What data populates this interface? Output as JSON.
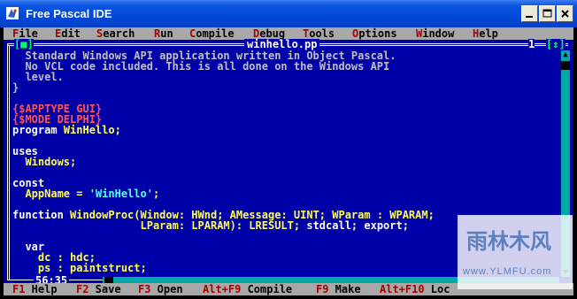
{
  "window": {
    "title": "Free Pascal IDE",
    "buttons": {
      "minimize": "_",
      "maximize": "□",
      "close": "✕"
    }
  },
  "menu": [
    {
      "label": "File",
      "hotkey": "F"
    },
    {
      "label": "Edit",
      "hotkey": "E"
    },
    {
      "label": "Search",
      "hotkey": "S"
    },
    {
      "label": "Run",
      "hotkey": "R"
    },
    {
      "label": "Compile",
      "hotkey": "C"
    },
    {
      "label": "Debug",
      "hotkey": "D"
    },
    {
      "label": "Tools",
      "hotkey": "T"
    },
    {
      "label": "Options",
      "hotkey": "O"
    },
    {
      "label": "Window",
      "hotkey": "W"
    },
    {
      "label": "Help",
      "hotkey": "H"
    }
  ],
  "editor": {
    "file_name": "winhello.pp",
    "close_glyph": "[■]",
    "window_number": "1",
    "zoom_glyph": "[↕]",
    "cursor_position": "56:35",
    "lines": [
      [
        {
          "t": "  Standard Windows API application written in Object Pascal.",
          "c": "gray"
        }
      ],
      [
        {
          "t": "  No VCL code included. This is all done on the Windows API",
          "c": "gray"
        }
      ],
      [
        {
          "t": "  level.",
          "c": "gray"
        }
      ],
      [
        {
          "t": "}",
          "c": "gray"
        }
      ],
      [
        {
          "t": "",
          "c": "white"
        }
      ],
      [
        {
          "t": "{$APPTYPE GUI}",
          "c": "red"
        }
      ],
      [
        {
          "t": "{$MODE DELPHI}",
          "c": "red"
        }
      ],
      [
        {
          "t": "program ",
          "c": "white"
        },
        {
          "t": "WinHello;",
          "c": "yellow"
        }
      ],
      [
        {
          "t": "",
          "c": "white"
        }
      ],
      [
        {
          "t": "uses",
          "c": "white"
        }
      ],
      [
        {
          "t": "  Windows;",
          "c": "yellow"
        }
      ],
      [
        {
          "t": "",
          "c": "white"
        }
      ],
      [
        {
          "t": "const",
          "c": "white"
        }
      ],
      [
        {
          "t": "  AppName = ",
          "c": "yellow"
        },
        {
          "t": "'WinHello'",
          "c": "cyan"
        },
        {
          "t": ";",
          "c": "yellow"
        }
      ],
      [
        {
          "t": "",
          "c": "white"
        }
      ],
      [
        {
          "t": "function ",
          "c": "white"
        },
        {
          "t": "WindowProc(Window: HWnd; AMessage: UINT; WParam : WPARAM;",
          "c": "yellow"
        }
      ],
      [
        {
          "t": "                    LParam: LPARAM): LRESULT; ",
          "c": "yellow"
        },
        {
          "t": "stdcall; export;",
          "c": "white"
        }
      ],
      [
        {
          "t": "",
          "c": "white"
        }
      ],
      [
        {
          "t": "  var",
          "c": "white"
        }
      ],
      [
        {
          "t": "    dc : hdc;",
          "c": "yellow"
        }
      ],
      [
        {
          "t": "    ps : paintstruct;",
          "c": "yellow"
        }
      ]
    ]
  },
  "statusbar": [
    {
      "key": "F1",
      "label": " Help"
    },
    {
      "key": "F2",
      "label": " Save"
    },
    {
      "key": "F3",
      "label": " Open"
    },
    {
      "key": "Alt+F9",
      "label": " Compile"
    },
    {
      "key": "F9",
      "label": " Make"
    },
    {
      "key": "Alt+F10",
      "label": " Loc"
    }
  ],
  "watermark": {
    "logo_text": "雨林木风",
    "url": "www.YLMFU.com"
  },
  "colors": {
    "desktop_blue": "#0000a8",
    "menu_gray": "#a8a8a8",
    "hotkey_red": "#a80000",
    "code_yellow": "#ffff54",
    "directive_red": "#ff5454",
    "string_cyan": "#54ffff"
  }
}
